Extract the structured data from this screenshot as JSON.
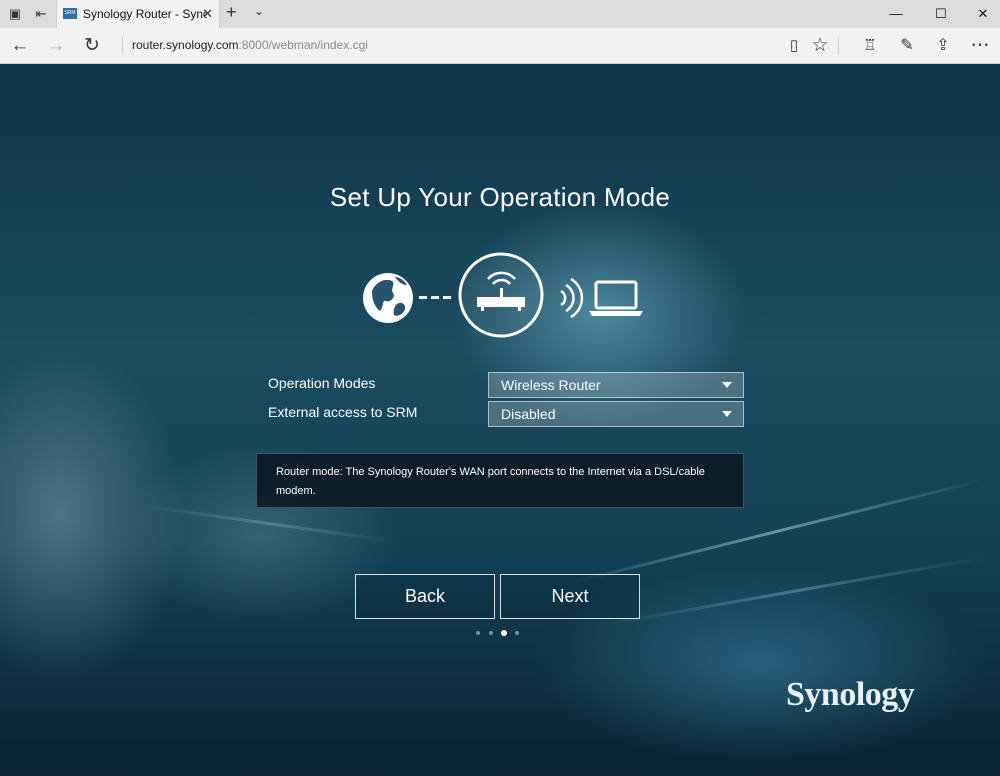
{
  "browser": {
    "tab_title": "Synology Router - Syno",
    "tab_favicon_text": "SRM",
    "url_host": "router.synology.com",
    "url_rest": ":8000/webman/index.cgi"
  },
  "page": {
    "title": "Set Up Your Operation Mode",
    "fields": [
      {
        "label": "Operation Modes",
        "value": "Wireless Router"
      },
      {
        "label": "External access to SRM",
        "value": "Disabled"
      }
    ],
    "description": "Router mode: The Synology Router's WAN port connects to the Internet via a DSL/cable modem.",
    "back_label": "Back",
    "next_label": "Next",
    "steps": {
      "total": 4,
      "current": 3
    },
    "logo": "Synology"
  },
  "icons": [
    "globe-icon",
    "router-icon",
    "wifi-signal-icon",
    "laptop-icon"
  ]
}
